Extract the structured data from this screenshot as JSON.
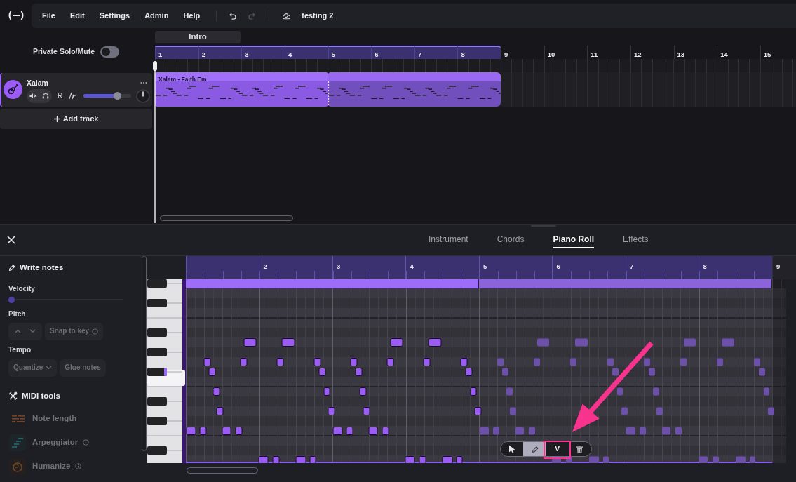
{
  "menu_bar": {
    "items": [
      {
        "label": "File"
      },
      {
        "label": "Edit"
      },
      {
        "label": "Settings"
      },
      {
        "label": "Admin"
      },
      {
        "label": "Help"
      }
    ],
    "undo": {
      "disabled": false
    },
    "redo": {
      "disabled": true
    },
    "project_title": "testing 2"
  },
  "arrangement": {
    "private_solo_mute": {
      "label": "Private Solo/Mute",
      "on": false
    },
    "sections": [
      {
        "label": "Intro"
      }
    ],
    "bars": [
      {
        "label": "1",
        "in_loop": true
      },
      {
        "label": "2",
        "in_loop": true
      },
      {
        "label": "3",
        "in_loop": true
      },
      {
        "label": "4",
        "in_loop": true
      },
      {
        "label": "5",
        "in_loop": true
      },
      {
        "label": "6",
        "in_loop": true
      },
      {
        "label": "7",
        "in_loop": true
      },
      {
        "label": "8",
        "in_loop": true
      },
      {
        "label": "9",
        "in_loop": false
      },
      {
        "label": "10",
        "in_loop": false
      },
      {
        "label": "11",
        "in_loop": false
      },
      {
        "label": "12",
        "in_loop": false
      },
      {
        "label": "13",
        "in_loop": false
      },
      {
        "label": "14",
        "in_loop": false
      },
      {
        "label": "15",
        "in_loop": false
      }
    ],
    "tracks": [
      {
        "name": "Xalam",
        "selected": true,
        "muted": false,
        "solo": false,
        "arm_label": "R",
        "armed": false,
        "level": 0.7,
        "clips": [
          {
            "name": "Xalam - Faith Em",
            "selected": true
          },
          {
            "selected": false
          }
        ]
      }
    ],
    "add_track": "Add track"
  },
  "editor": {
    "tabs": [
      {
        "label": "Instrument",
        "selected": false
      },
      {
        "label": "Chords",
        "selected": false
      },
      {
        "label": "Piano Roll",
        "selected": true
      },
      {
        "label": "Effects",
        "selected": false
      }
    ],
    "write_notes": "Write notes",
    "velocity": {
      "label": "Velocity",
      "level": 0
    },
    "pitch": {
      "label": "Pitch",
      "transpose_disabled": true,
      "snap_to_key": {
        "label": "Snap to key",
        "disabled": true
      }
    },
    "tempo": {
      "label": "Tempo",
      "quantize": {
        "label": "Quantize",
        "disabled": true
      },
      "glue_notes": {
        "label": "Glue notes",
        "disabled": true
      }
    },
    "midi_tools": {
      "title": "MIDI tools",
      "items": [
        {
          "kind": "note_length",
          "label": "Note length",
          "info": false,
          "disabled": true
        },
        {
          "kind": "arpeggiator",
          "label": "Arpeggiator",
          "info": true,
          "disabled": true
        },
        {
          "kind": "humanize",
          "label": "Humanize",
          "info": true,
          "disabled": true
        }
      ]
    },
    "piano_roll": {
      "bars": [
        {
          "label": "2",
          "in_loop": true
        },
        {
          "label": "3",
          "in_loop": true
        },
        {
          "label": "4",
          "in_loop": true
        },
        {
          "label": "5",
          "in_loop": true
        },
        {
          "label": "6",
          "in_loop": true
        },
        {
          "label": "7",
          "in_loop": true
        },
        {
          "label": "8",
          "in_loop": true
        },
        {
          "label": "9",
          "in_loop": false
        }
      ],
      "clips": [
        {
          "selected": true
        },
        {
          "selected": false
        }
      ],
      "tools": [
        {
          "kind": "pointer",
          "selected": false,
          "highlighted": false
        },
        {
          "kind": "pencil",
          "selected": true,
          "highlighted": false
        },
        {
          "kind": "letter",
          "label": "V",
          "selected": false,
          "highlighted": true
        },
        {
          "kind": "delete",
          "selected": false,
          "highlighted": false
        }
      ]
    }
  }
}
